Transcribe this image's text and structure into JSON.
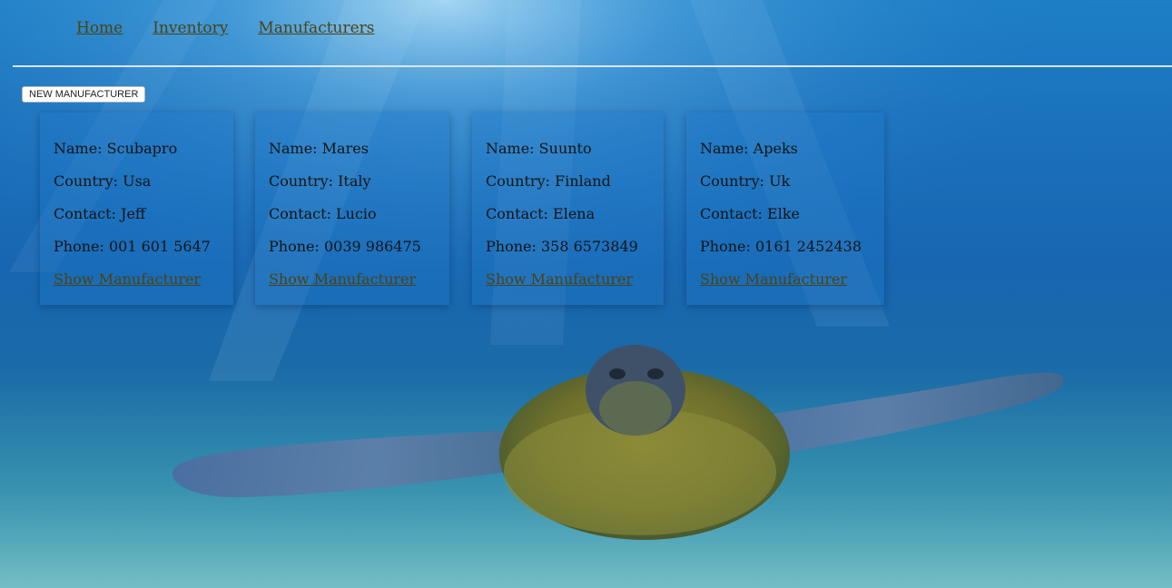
{
  "nav": {
    "home": "Home",
    "inventory": "Inventory",
    "manufacturers": "Manufacturers"
  },
  "toolbar": {
    "new_label": "NEW MANUFACTURER"
  },
  "labels": {
    "name": "Name:",
    "country": "Country:",
    "contact": "Contact:",
    "phone": "Phone:",
    "show": "Show Manufacturer"
  },
  "manufacturers": [
    {
      "name": "Scubapro",
      "country": "Usa",
      "contact": "Jeff",
      "phone": "001 601 5647"
    },
    {
      "name": "Mares",
      "country": "Italy",
      "contact": "Lucio",
      "phone": "0039 986475"
    },
    {
      "name": "Suunto",
      "country": "Finland",
      "contact": "Elena",
      "phone": "358 6573849"
    },
    {
      "name": "Apeks",
      "country": "Uk",
      "contact": "Elke",
      "phone": "0161 2452438"
    }
  ],
  "colors": {
    "link": "#4b4314",
    "water": "#1b72bd",
    "turtle_shell": "#7d7a32"
  },
  "icons": {
    "background": "sea-turtle-underwater-image"
  }
}
